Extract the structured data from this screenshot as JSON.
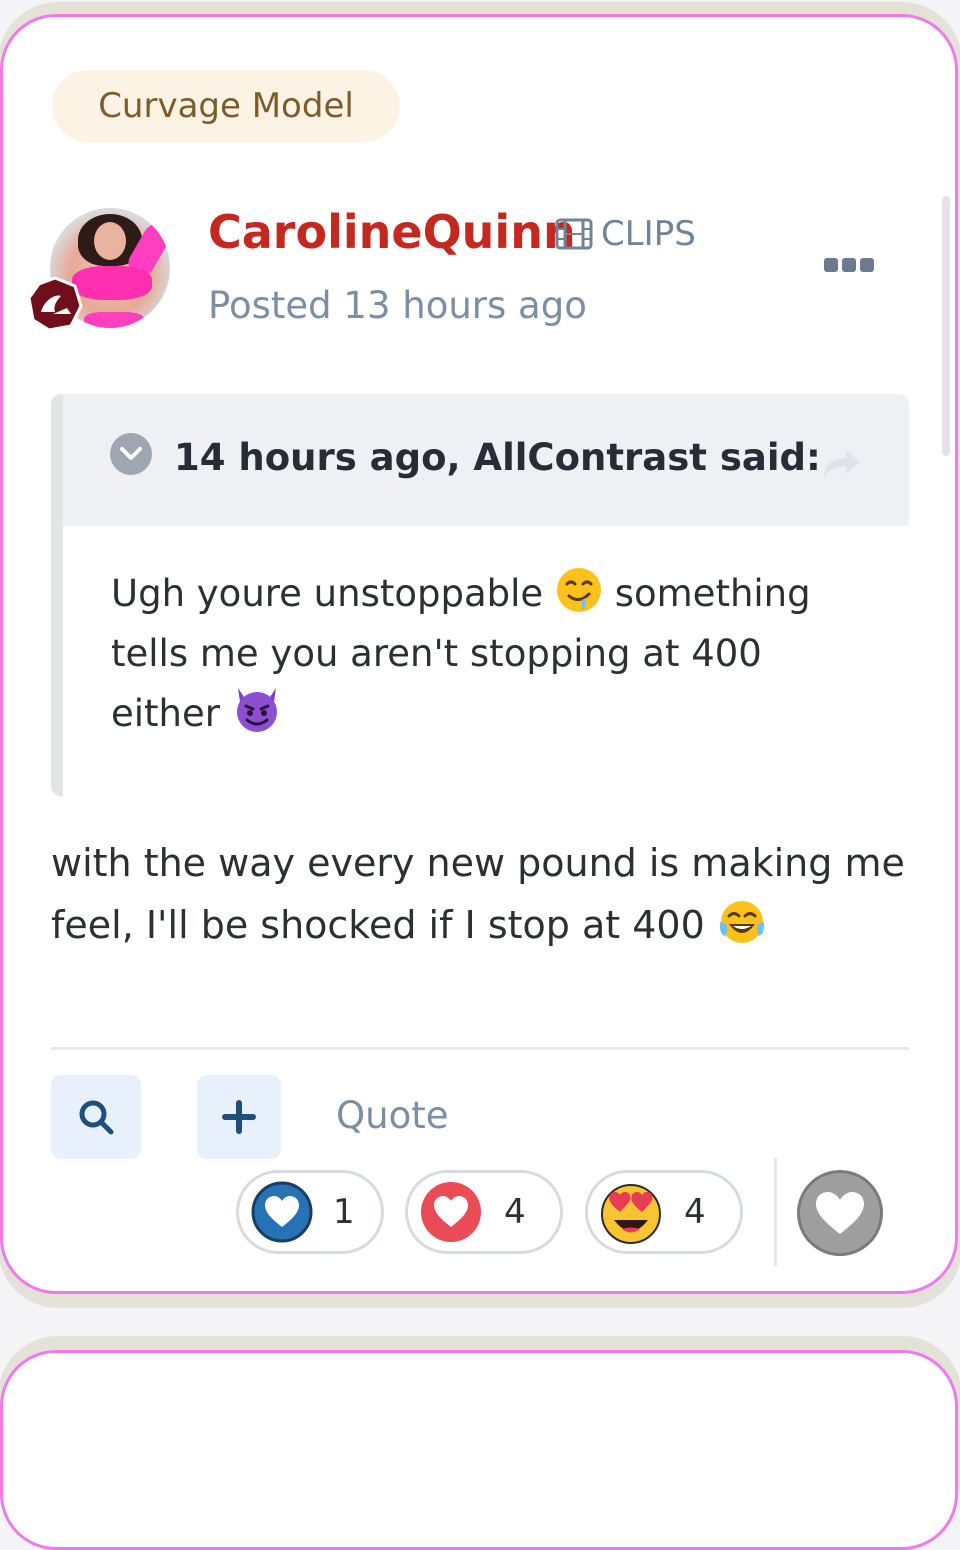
{
  "post": {
    "badge": "Curvage Model",
    "author": {
      "username": "CarolineQuinn",
      "tag": "CLIPS",
      "posted": "Posted 13 hours ago"
    },
    "quote": {
      "header": "14 hours ago, AllContrast said:",
      "text_part1": "Ugh youre unstoppable",
      "text_part2": "something tells me you aren't stopping at 400 either"
    },
    "body": "with the way every new pound is making me feel, I'll be shocked if I stop at 400",
    "actions": {
      "quote_label": "Quote"
    },
    "reactions": [
      {
        "name": "like",
        "count": "1",
        "icon": "blue-heart-icon",
        "color": "#2672b5"
      },
      {
        "name": "love",
        "count": "4",
        "icon": "red-heart-icon",
        "color": "#ea4b57"
      },
      {
        "name": "star-eyes",
        "count": "4",
        "icon": "heart-eyes-emoji-icon",
        "color": "#f7c531"
      }
    ]
  },
  "colors": {
    "username": "#c4281e",
    "card_border": "#ee7bea",
    "badge_bg": "#fdf3e4",
    "muted_text": "#7c8ea3"
  }
}
